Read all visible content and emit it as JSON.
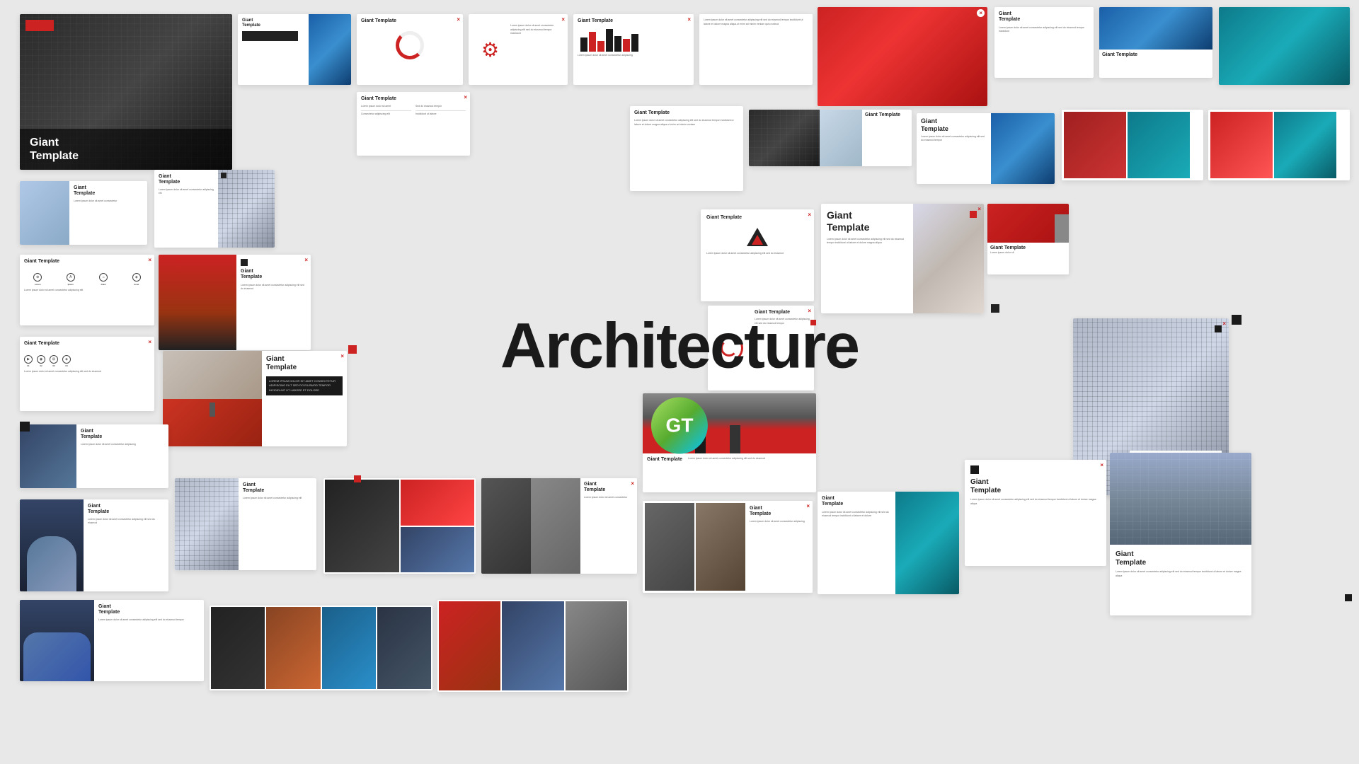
{
  "center": {
    "title": "Architecture",
    "logo_text": "GT"
  },
  "brand": {
    "name": "Giant Template",
    "accent_color": "#cc2222",
    "dark_color": "#1a1a1a"
  },
  "cards": [
    {
      "id": "c1",
      "title": "Giant\nTemplate",
      "position": "top-left-hero"
    },
    {
      "id": "c2",
      "title": "Giant Template",
      "position": "top-row-1"
    },
    {
      "id": "c3",
      "title": "Giant Template",
      "position": "top-row-2"
    },
    {
      "id": "c4",
      "title": "Giant Template",
      "position": "top-row-3"
    },
    {
      "id": "c5",
      "title": "Giant Template",
      "position": "top-row-4"
    },
    {
      "id": "c6",
      "title": "Giant Template",
      "position": "top-right-1"
    },
    {
      "id": "c7",
      "title": "Giant Template",
      "position": "top-right-2"
    }
  ],
  "lorem": "Lorem ipsum dolor sit amet, consectetur adipiscing elit. Sed do eiusmod tempor incididunt ut labore et dolore magna aliqua."
}
